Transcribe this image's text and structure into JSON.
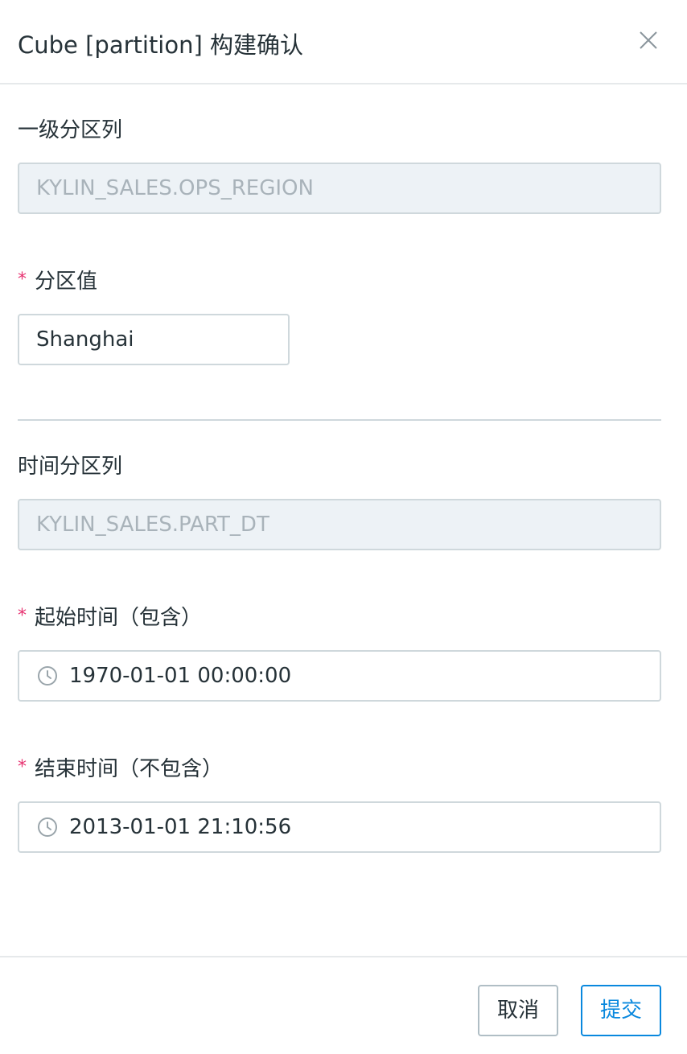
{
  "dialog": {
    "title": "Cube [partition] 构建确认",
    "close_icon": "close-icon"
  },
  "primary_partition": {
    "label": "一级分区列",
    "value": "KYLIN_SALES.OPS_REGION"
  },
  "partition_value": {
    "required_mark": "*",
    "label": "分区值",
    "value": "Shanghai"
  },
  "time_partition": {
    "label": "时间分区列",
    "value": "KYLIN_SALES.PART_DT"
  },
  "start_time": {
    "required_mark": "*",
    "label": "起始时间（包含）",
    "value": "1970-01-01 00:00:00",
    "icon": "clock-icon"
  },
  "end_time": {
    "required_mark": "*",
    "label": "结束时间（不包含）",
    "value": "2013-01-01 21:10:56",
    "icon": "clock-icon"
  },
  "footer": {
    "cancel_label": "取消",
    "submit_label": "提交"
  },
  "colors": {
    "accent": "#0988de",
    "required": "#e73371",
    "disabled_bg": "#edf2f6",
    "border": "#cfd8dc"
  }
}
